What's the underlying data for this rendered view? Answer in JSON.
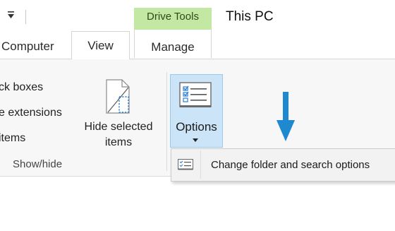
{
  "titlebar": {
    "contextual_tab_group": "Drive Tools",
    "window_title": "This PC"
  },
  "tabs": [
    {
      "label": "Computer"
    },
    {
      "label": "View"
    },
    {
      "label": "Manage"
    }
  ],
  "ribbon": {
    "show_hide": {
      "items": [
        "ck boxes",
        "e extensions",
        "items"
      ],
      "group_label": "Show/hide"
    },
    "hide_selected": {
      "line1": "Hide selected",
      "line2": "items"
    },
    "options": {
      "label": "Options"
    }
  },
  "dropdown": {
    "item_label": "Change folder and search options"
  },
  "colors": {
    "drive_tools_bg": "#c3e8a3",
    "options_hover_bg": "#cce4f7",
    "arrow": "#1e88d0"
  },
  "icons": [
    "dropdown-arrow-icon",
    "hide-selected-icon",
    "options-icon",
    "caret-down-icon",
    "arrow-down-icon",
    "folder-options-icon"
  ]
}
